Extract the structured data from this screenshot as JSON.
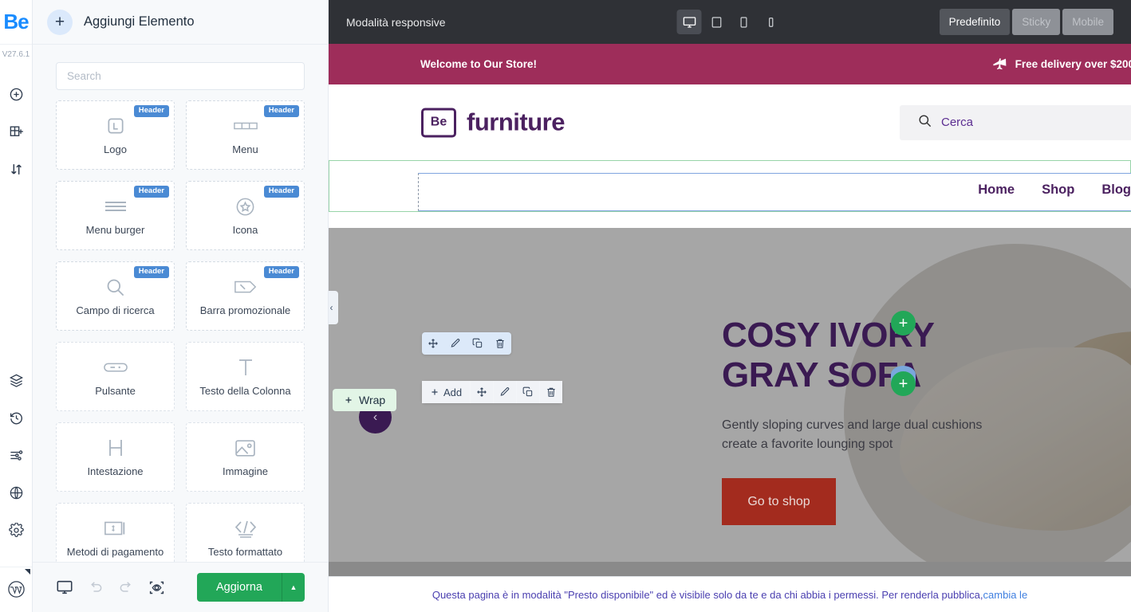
{
  "rail": {
    "logo": "Be",
    "version": "V27.6.1",
    "icons": [
      {
        "name": "add-element-icon",
        "label": "Aggiungi"
      },
      {
        "name": "add-section-icon",
        "label": "Sezione"
      },
      {
        "name": "reorder-icon",
        "label": "Ordina"
      },
      {
        "name": "layers-icon",
        "label": "Livelli"
      },
      {
        "name": "history-icon",
        "label": "Cronologia"
      },
      {
        "name": "settings-sliders-icon",
        "label": "Impostazioni"
      },
      {
        "name": "globe-icon",
        "label": "Globale"
      },
      {
        "name": "gear-icon",
        "label": "Opzioni"
      },
      {
        "name": "wordpress-icon",
        "label": "WordPress"
      }
    ]
  },
  "sidebar": {
    "title": "Aggiungi Elemento",
    "add_button": "+",
    "search": {
      "placeholder": "Search",
      "value": ""
    },
    "elements": [
      {
        "label": "Logo",
        "badge": "Header",
        "icon": "logo-icon"
      },
      {
        "label": "Menu",
        "badge": "Header",
        "icon": "menu-icon"
      },
      {
        "label": "Menu burger",
        "badge": "Header",
        "icon": "burger-icon"
      },
      {
        "label": "Icona",
        "badge": "Header",
        "icon": "star-circle-icon"
      },
      {
        "label": "Campo di ricerca",
        "badge": "Header",
        "icon": "search-icon"
      },
      {
        "label": "Barra promozionale",
        "badge": "Header",
        "icon": "tag-percent-icon"
      },
      {
        "label": "Pulsante",
        "badge": "",
        "icon": "button-icon"
      },
      {
        "label": "Testo della Colonna",
        "badge": "",
        "icon": "text-t-icon"
      },
      {
        "label": "Intestazione",
        "badge": "",
        "icon": "heading-h-icon"
      },
      {
        "label": "Immagine",
        "badge": "",
        "icon": "image-icon"
      },
      {
        "label": "Metodi di pagamento",
        "badge": "",
        "icon": "payment-icon"
      },
      {
        "label": "Testo formattato",
        "badge": "",
        "icon": "code-icon"
      }
    ],
    "footer": {
      "device_icon": "monitor-icon",
      "undo_icon": "undo-icon",
      "redo_icon": "redo-icon",
      "preview_icon": "preview-eye-icon",
      "update_label": "Aggiorna",
      "caret": "▲"
    }
  },
  "topbar": {
    "label": "Modalità responsive",
    "devices": [
      {
        "name": "desktop",
        "active": true
      },
      {
        "name": "laptop",
        "active": false
      },
      {
        "name": "tablet",
        "active": false
      },
      {
        "name": "mobile",
        "active": false
      }
    ],
    "modes": [
      {
        "label": "Predefinito",
        "state": "active"
      },
      {
        "label": "Sticky",
        "state": "off"
      },
      {
        "label": "Mobile",
        "state": "off"
      }
    ]
  },
  "site": {
    "promo": {
      "left_text": "Welcome to Our Store!",
      "right_icon": "airplane-icon",
      "right_text": "Free delivery over $200",
      "bg": "#9e2d5a"
    },
    "logo": {
      "mark": "Be",
      "text": "furniture",
      "color": "#4b2160"
    },
    "search": {
      "icon": "search-icon",
      "placeholder": "Cerca"
    },
    "nav": [
      "Home",
      "Shop",
      "Blog"
    ],
    "hero": {
      "title_line1": "COSY IVORY",
      "title_line2": "GRAY SOFA",
      "subtitle_line1": "Gently sloping curves and large dual cushions",
      "subtitle_line2": "create a favorite lounging spot",
      "cta": "Go to shop",
      "prev_arrow": "‹",
      "cta_color": "#a32b1e",
      "title_color": "#3a1a52"
    }
  },
  "editor_overlay": {
    "element_toolbar": [
      {
        "name": "move-icon",
        "glyph": "move"
      },
      {
        "name": "edit-pencil-icon",
        "glyph": "pencil"
      },
      {
        "name": "duplicate-icon",
        "glyph": "copy"
      },
      {
        "name": "delete-icon",
        "glyph": "trash"
      }
    ],
    "row_toolbar": [
      {
        "name": "add-button",
        "label": "Add"
      },
      {
        "name": "move-icon",
        "glyph": "move"
      },
      {
        "name": "edit-pencil-icon",
        "glyph": "pencil"
      },
      {
        "name": "duplicate-icon",
        "glyph": "copy"
      },
      {
        "name": "delete-icon",
        "glyph": "trash"
      }
    ],
    "wrap_label": "Wrap",
    "add_section_glyph": "+",
    "collapse_glyph": "‹"
  },
  "status": {
    "text": "Questa pagina è in modalità \"Presto disponibile\" ed è visibile solo da te e da chi abbia i permessi. Per renderla pubblica, ",
    "link": "cambia le"
  }
}
